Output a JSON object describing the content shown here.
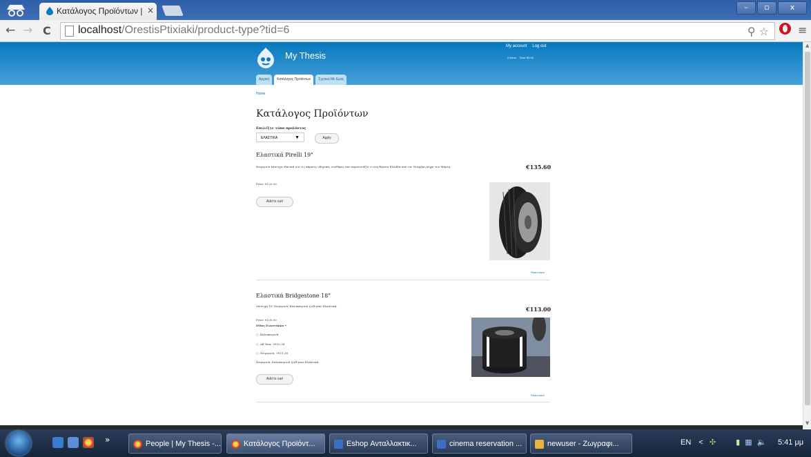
{
  "browser": {
    "tab_title": "Κατάλογος Προϊόντων | ",
    "tab_close": "×",
    "url_host": "localhost",
    "url_path": "/OrestisPtixiaki/product-type?tid=6",
    "back": "←",
    "forward": "→",
    "reload": "C",
    "win_min": "–",
    "win_max": "▫",
    "win_close": "x",
    "menu": "≡",
    "zoom_star": "⚲ ☆"
  },
  "site": {
    "name": "My Thesis",
    "my_account": "My account",
    "log_out": "Log out",
    "cart_items": "0 items",
    "cart_total": "Total: €0.00",
    "tabs": [
      "Αρχική",
      "Κατάλογος Προϊόντων",
      "Σχετικά Με Εμάς"
    ],
    "breadcrumb": "Home",
    "page_title": "Κατάλογος Προϊόντων"
  },
  "filter": {
    "label": "Επιλέξτε τύπο προϊόντος",
    "selected": "ΕΛΑΣΤΙΚΑ",
    "apply": "Apply"
  },
  "products": [
    {
      "title": "Ελαστικά Pirelli 19\"",
      "description": "Χειμερινά λάστιχα,ιδανικά για τις ακραίες οδηγικές συνθήκες που παρουσιάζει τι στη Βόρεια Ελλάδα από τον Νοέμβρη μέχρι τον Μάρτη.",
      "price_big": "€135.60",
      "price": "Price: €120.00",
      "add_to_cart": "Add to cart",
      "read_more": "Read more"
    },
    {
      "title": "Ελαστικά Bridgestone 18\"",
      "description": "Λάστιχα 18' Χειμερινά, Καλοκαιρινά ή all-year Ελαστικά.",
      "price_big": "€113.00",
      "price": "Price: €100.00",
      "option_label": "Είδος Ελαστικών *",
      "options": [
        "Καλοκαιρινά",
        "All Year, +€10.34",
        "Χειμερινά, +€11.30"
      ],
      "option_help": "Χειμερινά, Καλοκαιρινά ή all-year Ελαστικά",
      "add_to_cart": "Add to cart",
      "read_more": "Read more"
    }
  ],
  "taskbar": {
    "chevron": "»",
    "tasks": [
      "People | My Thesis -...",
      "Κατάλογος Προϊόντ...",
      "Eshop Ανταλλακτικ...",
      "cinema reservation ...",
      "newuser - Ζωγραφι..."
    ],
    "lang": "EN",
    "clock": "5:41 μμ"
  }
}
